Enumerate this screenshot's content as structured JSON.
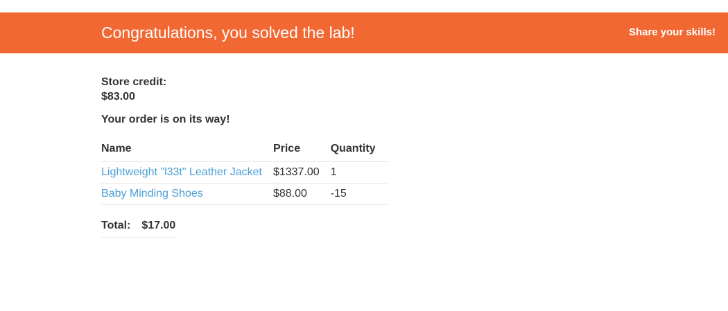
{
  "banner": {
    "title": "Congratulations, you solved the lab!",
    "share_label": "Share your skills!",
    "background": "#f26833"
  },
  "credit": {
    "label": "Store credit:",
    "value": "$83.00"
  },
  "order_message": "Your order is on its way!",
  "table": {
    "headers": [
      "Name",
      "Price",
      "Quantity"
    ],
    "rows": [
      {
        "name": "Lightweight \"l33t\" Leather Jacket",
        "price": "$1337.00",
        "quantity": "1"
      },
      {
        "name": "Baby Minding Shoes",
        "price": "$88.00",
        "quantity": "-15"
      }
    ]
  },
  "total": {
    "label": "Total:",
    "value": "$17.00"
  },
  "colors": {
    "link": "#4a9fd5",
    "text": "#333332"
  }
}
